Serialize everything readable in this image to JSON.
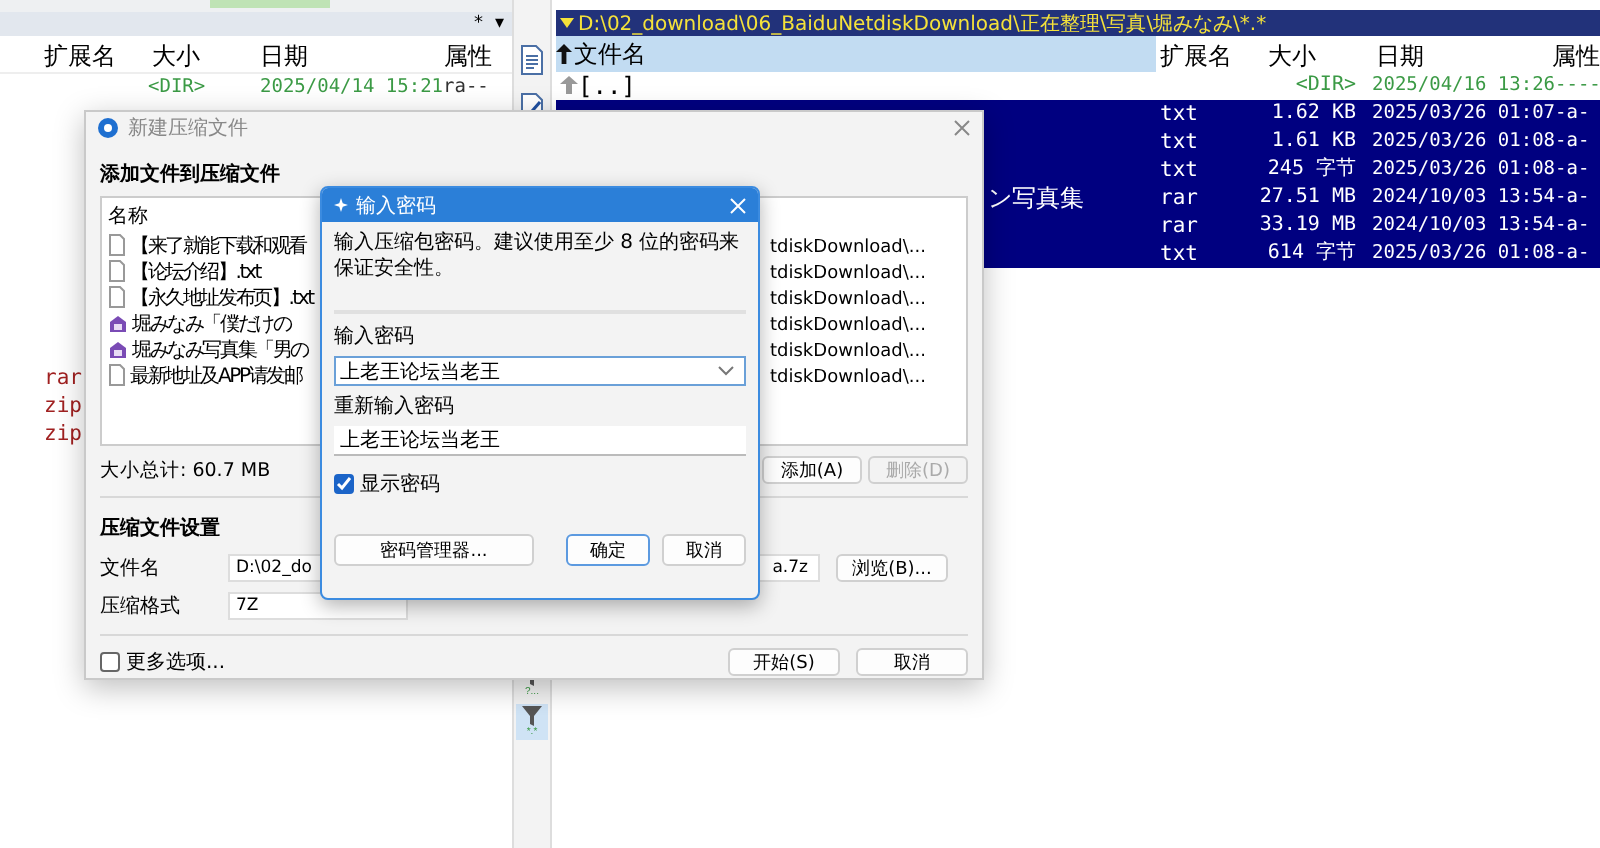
{
  "file_manager": {
    "left_panel": {
      "sort_marks": [
        "*",
        "▾"
      ],
      "columns": [
        "扩展名",
        "大小",
        "日期",
        "属性"
      ],
      "rows_top": [
        {
          "size": "<DIR>",
          "date": "2025/04/14 15:21",
          "attr": "ra--"
        }
      ],
      "rows_bottom": [
        {
          "ext": "rar"
        },
        {
          "ext": "zip"
        },
        {
          "ext": "zip"
        }
      ]
    },
    "side_toolbar": {
      "filters": [
        {
          "label": "?...",
          "selected": false
        },
        {
          "label": "*.*",
          "selected": true
        }
      ]
    },
    "right_panel": {
      "path": "D:\\02_download\\06_BaiduNetdiskDownload\\正在整理\\写真\\堀みなみ\\*.*",
      "columns": [
        "文件名",
        "扩展名",
        "大小",
        "日期",
        "属性"
      ],
      "parent_row": {
        "name": "[..]",
        "size": "<DIR>",
        "date": "2025/04/16 13:26",
        "attr": "----"
      },
      "rows": [
        {
          "ext": "txt",
          "size": "1.62 KB",
          "date": "2025/03/26 01:07",
          "attr": "-a-",
          "selected": true
        },
        {
          "ext": "txt",
          "size": "1.61 KB",
          "date": "2025/03/26 01:08",
          "attr": "-a-",
          "selected": true
        },
        {
          "ext": "txt",
          "size": "245 字节",
          "date": "2025/03/26 01:08",
          "attr": "-a-",
          "selected": true
        },
        {
          "name": "ン写真集",
          "kind": "tail",
          "ext": "rar",
          "size": "27.51 MB",
          "date": "2024/10/03 13:54",
          "attr": "-a-",
          "selected": true
        },
        {
          "ext": "rar",
          "size": "33.19 MB",
          "date": "2024/10/03 13:54",
          "attr": "-a-",
          "selected": true
        },
        {
          "ext": "txt",
          "size": "614 字节",
          "date": "2025/03/26 01:08",
          "attr": "-a-",
          "selected": true
        }
      ]
    }
  },
  "archive_dialog": {
    "title": "新建压缩文件",
    "section": "添加文件到压缩文件",
    "list_header": "名称",
    "files": [
      {
        "name": "【来了就能下载和观看",
        "kind": "text",
        "path": "tdiskDownload\\..."
      },
      {
        "name": "【论坛介绍】.txt",
        "kind": "text",
        "path": "tdiskDownload\\..."
      },
      {
        "name": "【永久地址发布页】.txt",
        "kind": "text",
        "path": "tdiskDownload\\..."
      },
      {
        "name": "堀みなみ「僕だけの",
        "kind": "archive",
        "path": "tdiskDownload\\..."
      },
      {
        "name": "堀みなみ写真集「男の",
        "kind": "archive",
        "path": "tdiskDownload\\..."
      },
      {
        "name": "最新地址及APP请发邮",
        "kind": "text",
        "path": "tdiskDownload\\..."
      }
    ],
    "total": "大小总计: 60.7 MB",
    "add_button": "添加(A)",
    "remove_button": {
      "label": "删除(D)",
      "disabled": true
    },
    "settings_title": "压缩文件设置",
    "filename_label": "文件名",
    "filename_value": "D:\\02_do",
    "filename_tail": "a.7z",
    "browse_button": "浏览(B)...",
    "format_label": "压缩格式",
    "format_value": "7Z",
    "more_options": {
      "label": "更多选项...",
      "checked": false
    },
    "start_button": "开始(S)",
    "cancel_button": "取消"
  },
  "password_dialog": {
    "title": "输入密码",
    "hint": "输入压缩包密码。建议使用至少 8 位的密码来保证安全性。",
    "password_label": "输入密码",
    "password": "上老王论坛当老王",
    "confirm_label": "重新输入密码",
    "confirm": "上老王论坛当老王",
    "show_password": {
      "label": "显示密码",
      "checked": true
    },
    "manager_button": "密码管理器...",
    "ok_button": "确定",
    "cancel_button": "取消"
  }
}
